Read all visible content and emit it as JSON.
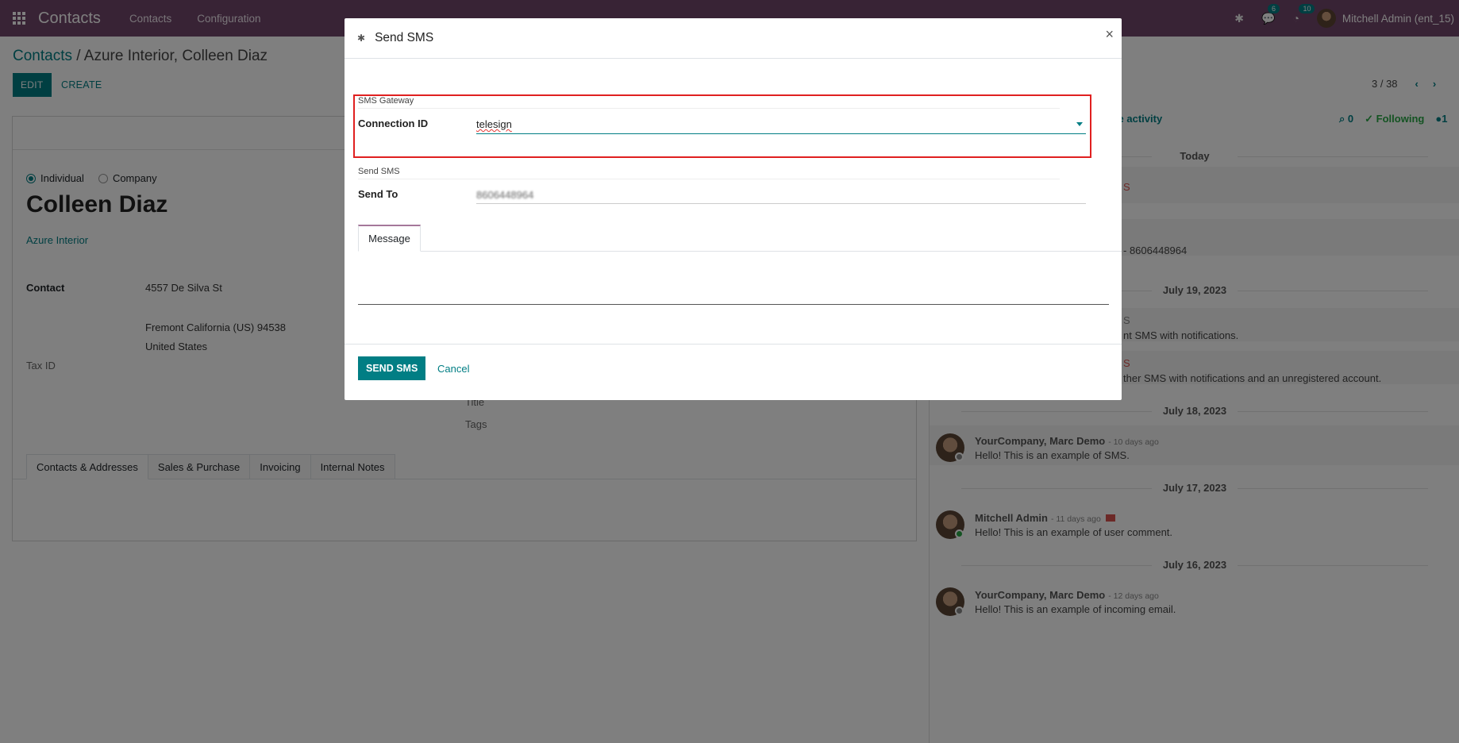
{
  "navbar": {
    "brand": "Contacts",
    "menu": [
      "Contacts",
      "Configuration"
    ],
    "chat_count": "6",
    "activity_count": "10",
    "user": "Mitchell Admin (ent_15)"
  },
  "breadcrumb": {
    "root": "Contacts",
    "sep": " / ",
    "current": "Azure Interior, Colleen Diaz"
  },
  "actions": {
    "edit": "EDIT",
    "create": "CREATE"
  },
  "pager": {
    "value": "3 / 38"
  },
  "form": {
    "type_options": [
      "Individual",
      "Company"
    ],
    "name": "Colleen Diaz",
    "company": "Azure Interior",
    "contact_label": "Contact",
    "street": "4557 De Silva St",
    "city_line": "Fremont  California (US)  94538",
    "country": "United States",
    "tax_label": "Tax ID",
    "title_label": "Title",
    "tags_label": "Tags",
    "tabs": [
      "Contacts & Addresses",
      "Sales & Purchase",
      "Invoicing",
      "Internal Notes"
    ]
  },
  "chatter": {
    "schedule": "ule activity",
    "attachments": "0",
    "following": "Following",
    "followers": "1",
    "dates": [
      "Today",
      "July 19, 2023",
      "July 18, 2023",
      "July 17, 2023",
      "July 16, 2023"
    ],
    "partial_red_1": "S",
    "partial_sent": "- 8606448964",
    "partial_red_2": "S",
    "partial_notif": "nt SMS with notifications.",
    "partial_red_3": "S",
    "partial_other": "ther SMS with notifications and an unregistered account.",
    "messages": [
      {
        "author": "YourCompany, Marc Demo",
        "ago": "- 10 days ago",
        "body": "Hello! This is an example of SMS."
      },
      {
        "author": "Mitchell Admin",
        "ago": "- 11 days ago",
        "body": "Hello! This is an example of user comment."
      },
      {
        "author": "YourCompany, Marc Demo",
        "ago": "- 12 days ago",
        "body": "Hello! This is an example of incoming email."
      }
    ]
  },
  "modal": {
    "title": "Send SMS",
    "close": "×",
    "gateway_section": "SMS Gateway",
    "connection_label": "Connection ID",
    "connection_value": "telesign",
    "send_section": "Send SMS",
    "send_to_label": "Send To",
    "send_to_value": "8606448964",
    "message_tab": "Message",
    "send_button": "SEND SMS",
    "cancel_button": "Cancel"
  }
}
